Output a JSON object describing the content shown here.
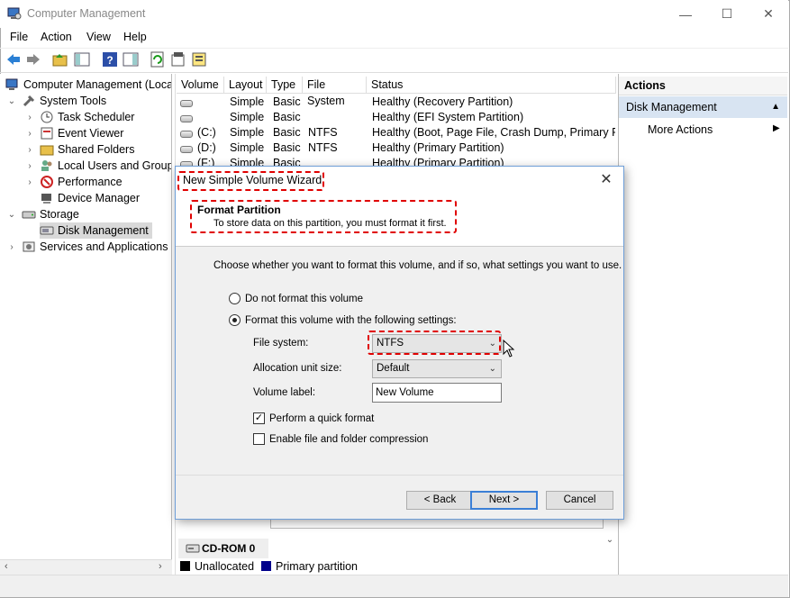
{
  "window": {
    "title": "Computer Management"
  },
  "menu": [
    "File",
    "Action",
    "View",
    "Help"
  ],
  "tree": {
    "root": "Computer Management (Local",
    "system_tools": "System Tools",
    "task_scheduler": "Task Scheduler",
    "event_viewer": "Event Viewer",
    "shared_folders": "Shared Folders",
    "local_users": "Local Users and Groups",
    "performance": "Performance",
    "device_manager": "Device Manager",
    "storage": "Storage",
    "disk_management": "Disk Management",
    "services": "Services and Applications"
  },
  "volumes": {
    "headers": [
      "Volume",
      "Layout",
      "Type",
      "File System",
      "Status"
    ],
    "rows": [
      {
        "volume": "",
        "layout": "Simple",
        "type": "Basic",
        "fs": "",
        "status": "Healthy (Recovery Partition)"
      },
      {
        "volume": "",
        "layout": "Simple",
        "type": "Basic",
        "fs": "",
        "status": "Healthy (EFI System Partition)"
      },
      {
        "volume": "(C:)",
        "layout": "Simple",
        "type": "Basic",
        "fs": "NTFS",
        "status": "Healthy (Boot, Page File, Crash Dump, Primary Part"
      },
      {
        "volume": "(D:)",
        "layout": "Simple",
        "type": "Basic",
        "fs": "NTFS",
        "status": "Healthy (Primary Partition)"
      },
      {
        "volume": "(F:)",
        "layout": "Simple",
        "type": "Basic",
        "fs": "",
        "status": "Healthy (Primary Partition)"
      }
    ]
  },
  "disk_label": "CD-ROM 0",
  "legend": {
    "unallocated": "Unallocated",
    "primary": "Primary partition",
    "unallocated_color": "#000000",
    "primary_color": "#00008b"
  },
  "actions": {
    "header": "Actions",
    "section": "Disk Management",
    "more": "More Actions"
  },
  "wizard": {
    "title": "New Simple Volume Wizard",
    "page_title": "Format Partition",
    "page_subtitle": "To store data on this partition, you must format it first.",
    "intro": "Choose whether you want to format this volume, and if so, what settings you want to use.",
    "opt_no_format": "Do not format this volume",
    "opt_format": "Format this volume with the following settings:",
    "fs_label": "File system:",
    "fs_value": "NTFS",
    "alloc_label": "Allocation unit size:",
    "alloc_value": "Default",
    "vol_label_label": "Volume label:",
    "vol_label_value": "New Volume",
    "quick_format": "Perform a quick format",
    "compression": "Enable file and folder compression",
    "back": "< Back",
    "next": "Next >",
    "cancel": "Cancel",
    "format_selected": true,
    "quick_checked": true,
    "compression_checked": false
  },
  "highlight_color": "#e00000"
}
